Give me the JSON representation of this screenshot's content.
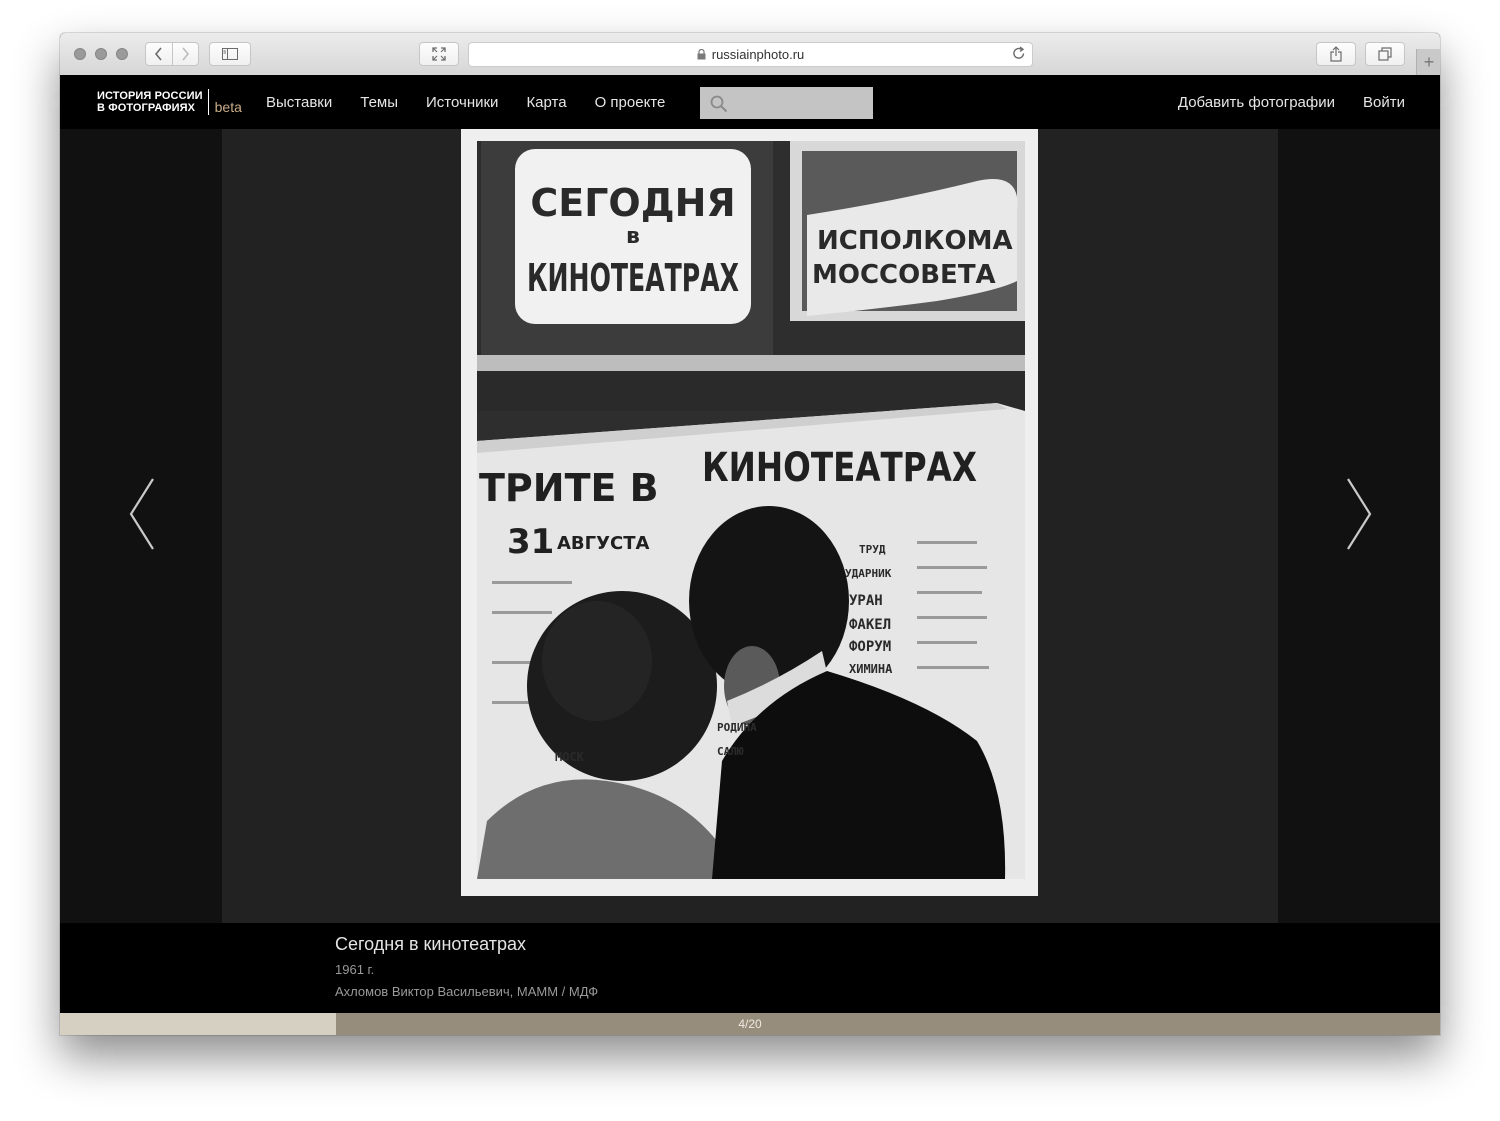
{
  "browser": {
    "url": "russiainphoto.ru"
  },
  "site": {
    "logo_line1": "ИСТОРИЯ РОССИИ",
    "logo_line2": "В ФОТОГРАФИЯХ",
    "logo_badge": "beta",
    "nav": [
      "Выставки",
      "Темы",
      "Источники",
      "Карта",
      "О проекте"
    ],
    "search_placeholder": "",
    "add_photos": "Добавить фотографии",
    "login": "Войти"
  },
  "photo": {
    "sign_top_left": [
      "СЕГОДНЯ",
      "в",
      "КИНОТЕАТРАХ"
    ],
    "sign_top_right": [
      "ИСПОЛКОМА",
      "МОССОВЕТА"
    ],
    "poster_heading_left": "ТРИТЕ В",
    "poster_heading_right": "КИНОТЕАТРАХ",
    "poster_date": "31",
    "poster_month": "АВГУСТА",
    "poster_cinemas": [
      "ТРУД",
      "УДАРНИК",
      "УРАН",
      "ФАКЕЛ",
      "ФОРУМ",
      "ХИМИНА"
    ],
    "poster_lower": [
      "РОДИНА",
      "САЛЮ",
      "МОСК"
    ]
  },
  "caption": {
    "title": "Сегодня в кинотеатрах",
    "year": "1961 г.",
    "credit": "Ахломов Виктор Васильевич, МАММ / МДФ"
  },
  "slideshow": {
    "current": 4,
    "total": 20,
    "label": "4/20",
    "progress_fraction": 0.2
  },
  "colors": {
    "progress_fill": "#d6d0c3",
    "progress_track": "#978d7d",
    "beta_accent": "#c8ad86"
  }
}
